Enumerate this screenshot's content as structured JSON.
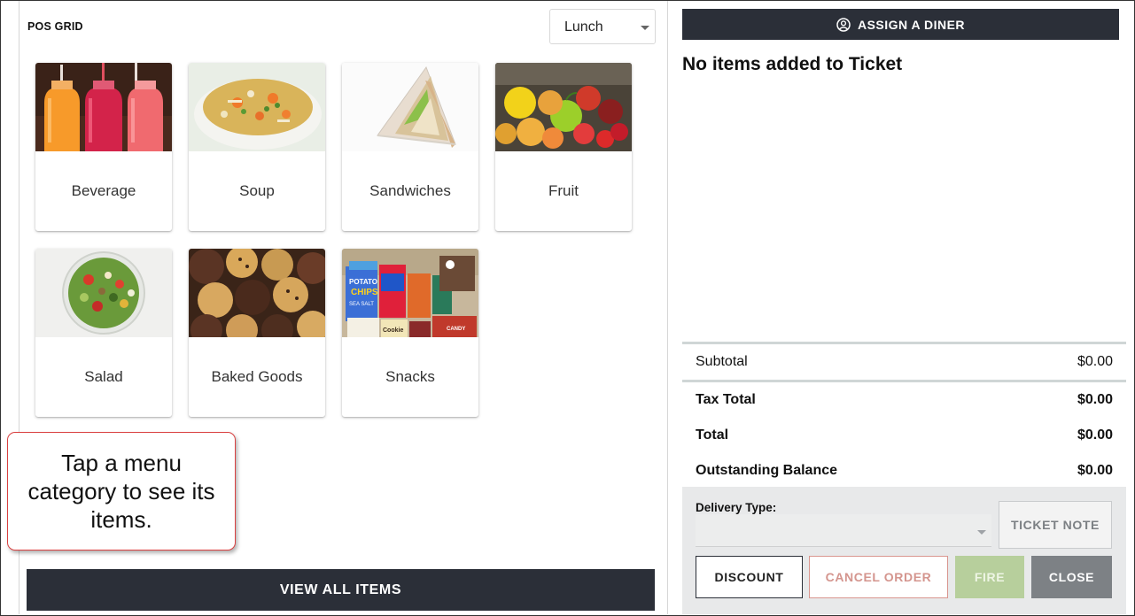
{
  "pos": {
    "title": "POS GRID",
    "meal_period": "Lunch"
  },
  "categories": [
    {
      "label": "Beverage",
      "icon": "beverage-image"
    },
    {
      "label": "Soup",
      "icon": "soup-image"
    },
    {
      "label": "Sandwiches",
      "icon": "sandwich-image"
    },
    {
      "label": "Fruit",
      "icon": "fruit-image"
    },
    {
      "label": "Salad",
      "icon": "salad-image"
    },
    {
      "label": "Baked Goods",
      "icon": "baked-goods-image"
    },
    {
      "label": "Snacks",
      "icon": "snacks-image"
    }
  ],
  "snack_labels": {
    "potato": "POTATO",
    "chips": "CHIPS",
    "sea_salt": "SEA SALT",
    "cookie": "Cookie",
    "candy": "CANDY"
  },
  "callout": "Tap a menu category to see its items.",
  "view_all_label": "VIEW ALL ITEMS",
  "ticket": {
    "assign_label": "ASSIGN A DINER",
    "empty_message": "No items added to Ticket",
    "totals": {
      "subtotal_label": "Subtotal",
      "subtotal_value": "$0.00",
      "tax_label": "Tax Total",
      "tax_value": "$0.00",
      "total_label": "Total",
      "total_value": "$0.00",
      "outstanding_label": "Outstanding Balance",
      "outstanding_value": "$0.00"
    },
    "delivery_type_label": "Delivery Type:",
    "delivery_type_value": "",
    "ticket_note_label": "TICKET NOTE",
    "discount_label": "DISCOUNT",
    "cancel_label": "CANCEL ORDER",
    "fire_label": "FIRE",
    "close_label": "CLOSE"
  },
  "colors": {
    "dark_button": "#2b2f38",
    "fire_button": "#b7cf9c",
    "close_button": "#7d8185",
    "cancel_text": "#d4958e",
    "callout_border": "#d94040"
  }
}
